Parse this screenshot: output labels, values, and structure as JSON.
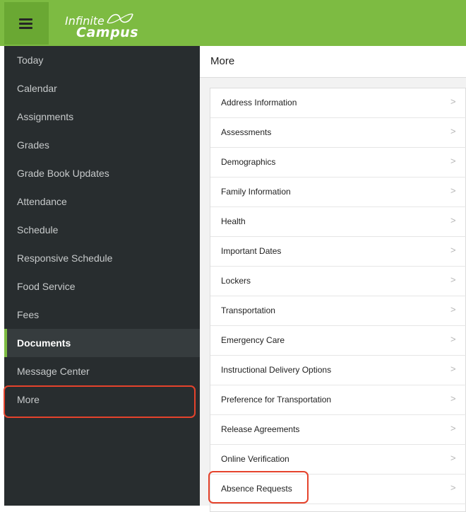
{
  "header": {
    "logo_line1": "Infinite",
    "logo_line2": "Campus",
    "brand_color": "#7dbb42"
  },
  "sidebar": {
    "items": [
      {
        "label": "Today"
      },
      {
        "label": "Calendar"
      },
      {
        "label": "Assignments"
      },
      {
        "label": "Grades"
      },
      {
        "label": "Grade Book Updates"
      },
      {
        "label": "Attendance"
      },
      {
        "label": "Schedule"
      },
      {
        "label": "Responsive Schedule"
      },
      {
        "label": "Food Service"
      },
      {
        "label": "Fees"
      },
      {
        "label": "Documents"
      },
      {
        "label": "Message Center"
      },
      {
        "label": "More"
      }
    ],
    "active_item": "Documents"
  },
  "main": {
    "title": "More",
    "chevron": ">",
    "items": [
      {
        "label": "Address Information"
      },
      {
        "label": "Assessments"
      },
      {
        "label": "Demographics"
      },
      {
        "label": "Family Information"
      },
      {
        "label": "Health"
      },
      {
        "label": "Important Dates"
      },
      {
        "label": "Lockers"
      },
      {
        "label": "Transportation"
      },
      {
        "label": "Emergency Care"
      },
      {
        "label": "Instructional Delivery Options"
      },
      {
        "label": "Preference for Transportation"
      },
      {
        "label": "Release Agreements"
      },
      {
        "label": "Online Verification"
      },
      {
        "label": "Absence Requests"
      }
    ]
  },
  "annotations": {
    "callout_color": "#e5432c",
    "highlighted": [
      "More",
      "Absence Requests"
    ]
  }
}
